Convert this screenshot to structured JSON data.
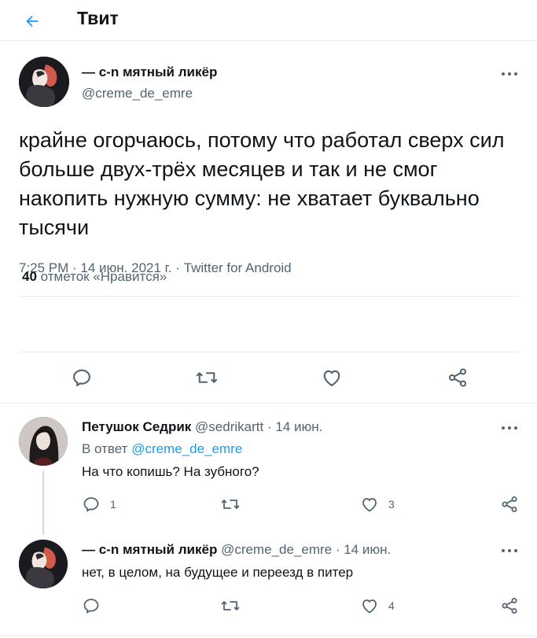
{
  "header": {
    "title": "Твит",
    "back_icon": "arrow-left-icon"
  },
  "main_tweet": {
    "author_name": "— c-n мятный ликёр",
    "author_handle": "@creme_de_emre",
    "text": "крайне огорчаюсь, потому что работал сверх сил больше двух-трёх месяцев и так и не смог накопить нужную сумму: не хватает буквально тысячи",
    "meta": "7:25 PM · 14 июн. 2021 г. · Twitter for Android",
    "likes_count": "40",
    "likes_label": "отметок «Нравится»"
  },
  "replies": [
    {
      "author_name": "Петушок Седрик",
      "author_handle": "@sedrikartt",
      "date": "· 14 июн.",
      "reply_to_label": "В ответ",
      "reply_to_handle": "@creme_de_emre",
      "text": "На что копишь? На зубного?",
      "reply_count": "1",
      "retweet_count": "",
      "like_count": "3"
    },
    {
      "author_name": "— c-n мятный ликёр",
      "author_handle": "@creme_de_emre",
      "date": "· 14 июн.",
      "text": "нет, в целом, на будущее и переезд в питер",
      "reply_count": "",
      "retweet_count": "",
      "like_count": "4"
    }
  ],
  "colors": {
    "accent": "#1d9bf0",
    "secondary_text": "#536471",
    "divider": "#e6ecf0"
  }
}
